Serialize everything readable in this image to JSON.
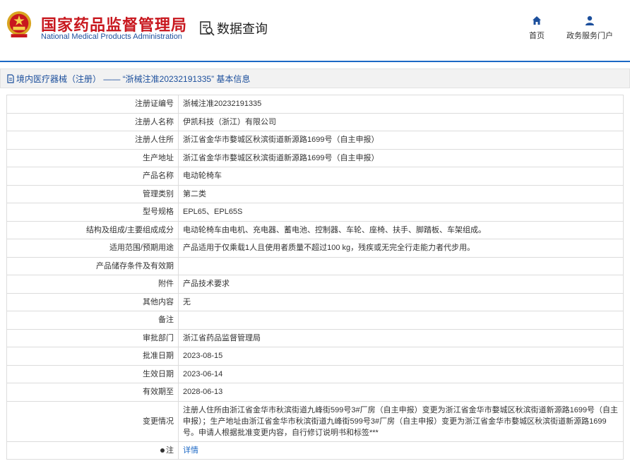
{
  "header": {
    "brand_cn": "国家药品监督管理局",
    "brand_en": "National Medical Products Administration",
    "query_title": "数据查询",
    "nav_home": "首页",
    "nav_portal": "政务服务门户",
    "logo_icon": "national-emblem-icon",
    "brand_color": "#c8171e",
    "accent_color": "#1c68c5"
  },
  "breadcrumb": {
    "text": "境内医疗器械（注册） —— “浙械注准20232191335” 基本信息"
  },
  "rows": [
    {
      "label": "注册证编号",
      "value": "浙械注准20232191335"
    },
    {
      "label": "注册人名称",
      "value": "伊凯科技（浙江）有限公司"
    },
    {
      "label": "注册人住所",
      "value": "浙江省金华市婺城区秋滨街道新源路1699号（自主申报）"
    },
    {
      "label": "生产地址",
      "value": "浙江省金华市婺城区秋滨街道新源路1699号（自主申报）"
    },
    {
      "label": "产品名称",
      "value": "电动轮椅车"
    },
    {
      "label": "管理类别",
      "value": "第二类"
    },
    {
      "label": "型号规格",
      "value": "EPL65、EPL65S"
    },
    {
      "label": "结构及组成/主要组成成分",
      "value": "电动轮椅车由电机、充电器、蓄电池、控制器、车轮、座椅、扶手、脚踏板、车架组成。"
    },
    {
      "label": "适用范围/预期用途",
      "value": "产品适用于仅乘载1人且使用者质量不超过100 kg，残疾或无完全行走能力者代步用。"
    },
    {
      "label": "产品储存条件及有效期",
      "value": ""
    },
    {
      "label": "附件",
      "value": "产品技术要求"
    },
    {
      "label": "其他内容",
      "value": "无"
    },
    {
      "label": "备注",
      "value": ""
    },
    {
      "label": "审批部门",
      "value": "浙江省药品监督管理局"
    },
    {
      "label": "批准日期",
      "value": "2023-08-15"
    },
    {
      "label": "生效日期",
      "value": "2023-06-14"
    },
    {
      "label": "有效期至",
      "value": "2028-06-13"
    },
    {
      "label": "变更情况",
      "value": "注册人住所由浙江省金华市秋滨街道九峰街599号3#厂房（自主申报）变更为浙江省金华市婺城区秋滨街道新源路1699号（自主申报）；生产地址由浙江省金华市秋滨街道九峰街599号3#厂房（自主申报）变更为浙江省金华市婺城区秋滨街道新源路1699号。申请人根据批准变更内容，自行修订说明书和标签***"
    }
  ],
  "note": {
    "label": "注",
    "link_text": "详情"
  }
}
